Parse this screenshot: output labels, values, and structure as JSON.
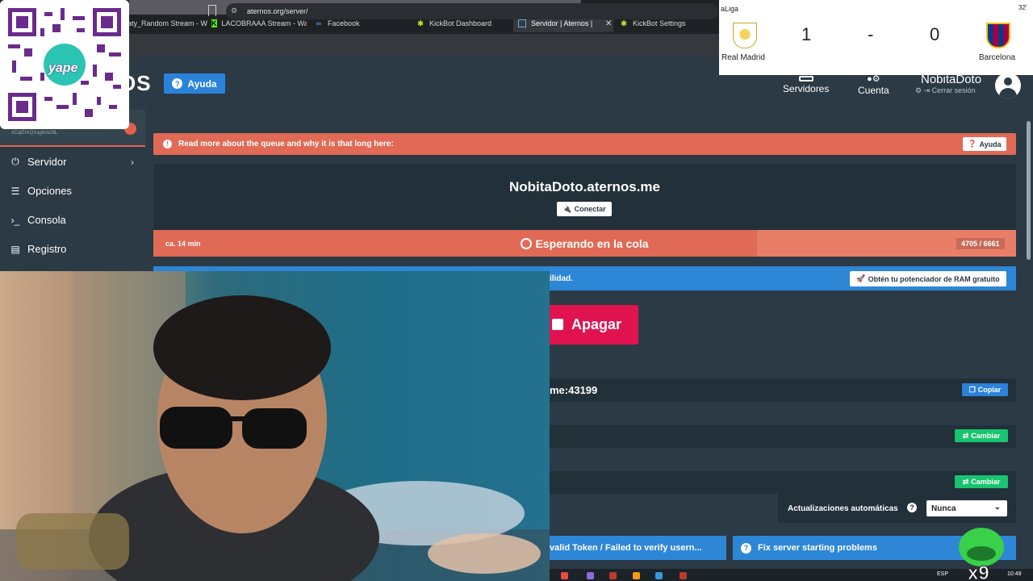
{
  "browser": {
    "tabs": [
      {
        "label": "aty_Random Stream - W",
        "icon": "stream-icon"
      },
      {
        "label": "LACOBRAAA Stream - Wa",
        "icon": "kick-icon"
      },
      {
        "label": "Facebook",
        "icon": "facebook-icon"
      },
      {
        "label": "KickBot Dashboard",
        "icon": "kickbot-icon"
      },
      {
        "label": "Servidor | Aternos | Se",
        "icon": "aternos-icon",
        "active": true
      },
      {
        "label": "KickBot Settings",
        "icon": "kickbot-icon"
      }
    ],
    "address": "aternos.org/server/"
  },
  "header": {
    "logo_fragment": "OS",
    "help_label": "Ayuda",
    "nav": [
      {
        "label": "Servidores",
        "icon": "server-icon"
      },
      {
        "label": "Cuenta",
        "icon": "user-gear-icon"
      }
    ],
    "username": "NobitaDoto",
    "logout_label": "Cerrar sesión"
  },
  "sidebar": {
    "server_id": "#CqlEHrQXag6xk28L",
    "items": [
      {
        "label": "Servidor",
        "icon": "power-icon"
      },
      {
        "label": "Opciones",
        "icon": "options-icon"
      },
      {
        "label": "Consola",
        "icon": "console-icon"
      },
      {
        "label": "Registro",
        "icon": "log-icon"
      }
    ]
  },
  "main": {
    "queue_info": "Read more about the queue and why it is that long here:",
    "queue_help": "Ayuda",
    "server_address": "NobitaDoto.aternos.me",
    "connect_label": "Conectar",
    "eta": "ca. 14 min",
    "status": "Esperando en la cola",
    "queue_position": "4705 / 6661",
    "queue_progress": 0.7,
    "ram_text": "ilidad.",
    "ram_button": "Obtén tu potenciador de RAM gratuito",
    "stop_label": "Apagar",
    "ip_fragment": "me:43199",
    "copy_label": "Copiar",
    "change_label": "Cambiar",
    "auto_update_label": "Actualizaciones automáticas",
    "auto_update_value": "Nunca",
    "faq": [
      "valid Token / Failed to verify usern...",
      "Fix server starting problems"
    ]
  },
  "taskbar": {
    "language": "ESP",
    "time": "10:49"
  },
  "overlays": {
    "yape": "yape",
    "scoreboard": {
      "league": "aLiga",
      "minute": "32'",
      "home_team": "Real Madrid",
      "away_team": "Barcelona",
      "home_score": "1",
      "separator": "-",
      "away_score": "0"
    }
  },
  "colors": {
    "page_bg": "#2b3a45",
    "panel_bg": "#22303a",
    "queue_red": "#e06a55",
    "blue": "#2e86d6",
    "stop_red": "#e0134f",
    "green": "#19c46f"
  }
}
